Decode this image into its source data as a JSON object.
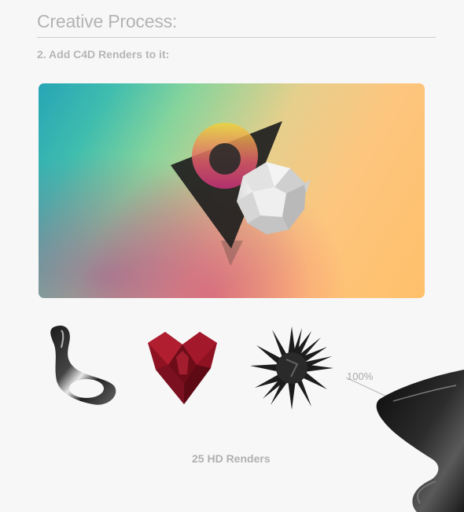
{
  "header": {
    "title": "Creative Process:",
    "step": "2. Add C4D Renders to it:"
  },
  "gallery": {
    "zoom_label": "100%",
    "caption": "25 HD Renders",
    "renders": [
      "chrome-ring-render",
      "red-origami-heart-render",
      "black-spiky-ball-render"
    ]
  }
}
